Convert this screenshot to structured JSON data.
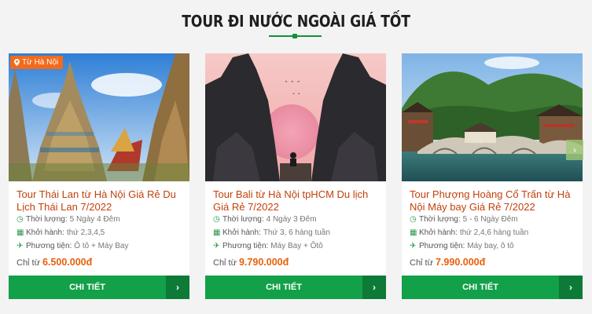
{
  "section": {
    "title": "TOUR ĐI NƯỚC NGOÀI GIÁ TỐT"
  },
  "colors": {
    "accent": "#12a049",
    "price": "#e8600c",
    "title": "#c2410c",
    "badge": "#f26a1b"
  },
  "cards": [
    {
      "badge": "Từ Hà Nội",
      "title": "Tour Thái Lan từ Hà Nội Giá Rẻ Du Lịch Thái Lan 7/2022",
      "duration_label": "Thời lượng:",
      "duration": "5 Ngày 4 Đêm",
      "depart_label": "Khởi hành:",
      "depart": "thứ 2,3,4,5",
      "transport_label": "Phương tiện:",
      "transport": "Ô tô + Máy Bay",
      "price_label": "Chỉ từ",
      "price": "6.500.000đ",
      "cta": "CHI TIẾT"
    },
    {
      "title": "Tour Bali từ Hà Nội tpHCM Du lịch Giá Rẻ 7/2022",
      "duration_label": "Thời lượng:",
      "duration": "4 Ngày 3 Đêm",
      "depart_label": "Khởi hành:",
      "depart": "Thứ 3, 6 hàng tuần",
      "transport_label": "Phương tiện:",
      "transport": "Máy Bay + Ôtô",
      "price_label": "Chỉ từ",
      "price": "9.790.000đ",
      "cta": "CHI TIẾT"
    },
    {
      "title": "Tour Phượng Hoàng Cổ Trấn từ Hà Nội Máy bay Giá Rẻ 7/2022",
      "duration_label": "Thời lượng:",
      "duration": "5 - 6 Ngày Đêm",
      "depart_label": "Khởi hành:",
      "depart": "thứ 2,4,6 hàng tuần",
      "transport_label": "Phương tiện:",
      "transport": "Máy bay, ô tô",
      "price_label": "Chỉ từ",
      "price": "7.990.000đ",
      "cta": "CHI TIẾT"
    }
  ],
  "icons": {
    "badge": "map-pin-icon",
    "duration": "clock-icon",
    "depart": "calendar-icon",
    "transport": "plane-icon",
    "cta_arrow": "chevron-right-icon",
    "slider": "chevron-right-icon"
  }
}
